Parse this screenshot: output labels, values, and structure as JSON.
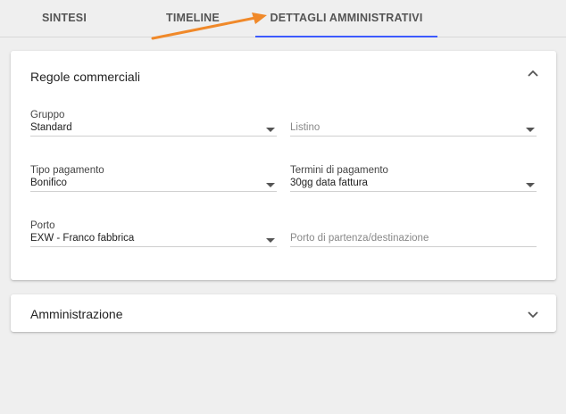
{
  "tabs": [
    {
      "label": "SINTESI"
    },
    {
      "label": "TIMELINE"
    },
    {
      "label": "DETTAGLI AMMINISTRATIVI",
      "active": true
    }
  ],
  "colors": {
    "accent": "#3d5afe",
    "arrow": "#f0892a"
  },
  "section_commercial": {
    "title": "Regole commerciali",
    "expanded": true,
    "fields": {
      "gruppo": {
        "label": "Gruppo",
        "value": "Standard"
      },
      "listino": {
        "placeholder": "Listino"
      },
      "tipo_pagamento": {
        "label": "Tipo pagamento",
        "value": "Bonifico"
      },
      "termini": {
        "label": "Termini di pagamento",
        "value": "30gg data fattura"
      },
      "porto": {
        "label": "Porto",
        "value": "EXW - Franco fabbrica"
      },
      "porto_partenza": {
        "placeholder": "Porto di partenza/destinazione"
      }
    }
  },
  "section_admin": {
    "title": "Amministrazione",
    "expanded": false
  }
}
